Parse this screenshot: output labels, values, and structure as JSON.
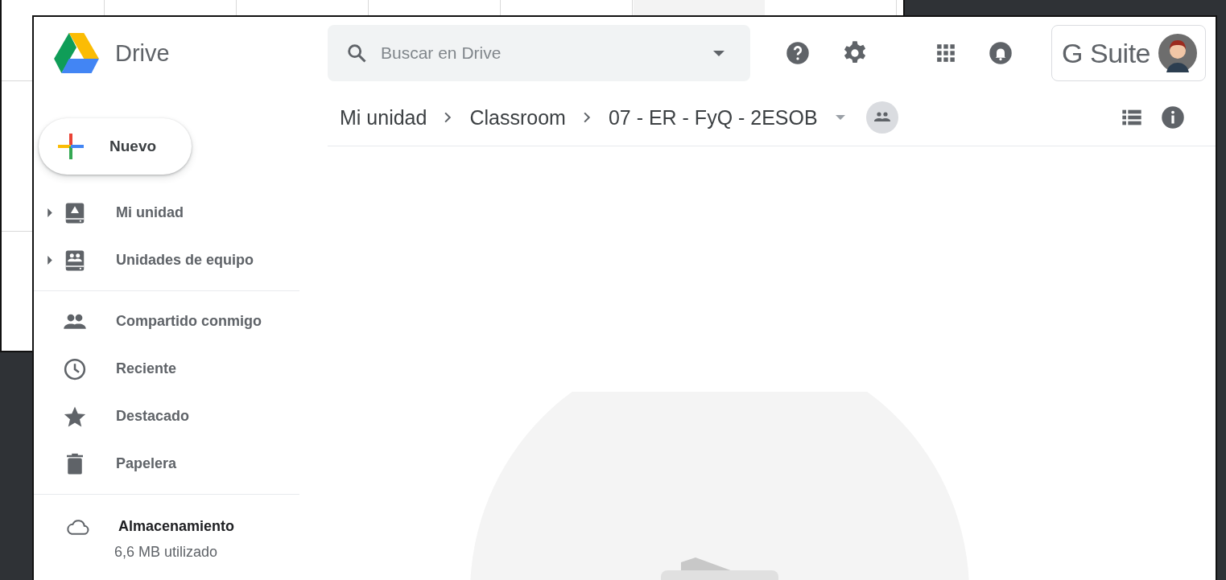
{
  "header": {
    "app_name": "Drive",
    "search": {
      "placeholder": "Buscar en Drive"
    },
    "brand": "G Suite"
  },
  "sidebar": {
    "new_button": "Nuevo",
    "sections": [
      [
        {
          "label": "Mi unidad",
          "expandable": true
        },
        {
          "label": "Unidades de equipo",
          "expandable": true
        }
      ],
      [
        {
          "label": "Compartido conmigo",
          "expandable": false
        },
        {
          "label": "Reciente",
          "expandable": false
        },
        {
          "label": "Destacado",
          "expandable": false
        },
        {
          "label": "Papelera",
          "expandable": false
        }
      ]
    ],
    "storage": {
      "label": "Almacenamiento",
      "usage": "6,6 MB utilizado"
    }
  },
  "breadcrumb": [
    {
      "label": "Mi unidad"
    },
    {
      "label": "Classroom"
    },
    {
      "label": "07 - ER - FyQ - 2ESOB"
    }
  ]
}
